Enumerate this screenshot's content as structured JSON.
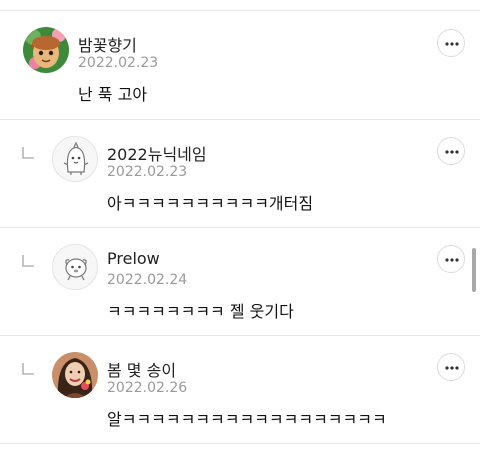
{
  "comments": [
    {
      "author": "밤꽃향기",
      "date": "2022.02.23",
      "text": "난 푹 고아",
      "is_reply": false,
      "avatar_icon": "profile-photo-avatar"
    },
    {
      "author": "2022뉴닉네임",
      "date": "2022.02.23",
      "text": "아ㅋㅋㅋㅋㅋㅋㅋㅋㅋㅋ개터짐",
      "is_reply": true,
      "avatar_icon": "default-character-avatar"
    },
    {
      "author": "Prelow",
      "date": "2022.02.24",
      "text": "ㅋㅋㅋㅋㅋㅋㅋㅋ 젤 웃기다",
      "is_reply": true,
      "avatar_icon": "default-character-avatar"
    },
    {
      "author": "봄 몇 송이",
      "date": "2022.02.26",
      "text": "알ㅋㅋㅋㅋㅋㅋㅋㅋㅋㅋㅋㅋㅋㅋㅋㅋㅋㅋ",
      "is_reply": true,
      "avatar_icon": "profile-photo-avatar"
    }
  ],
  "icons": {
    "more": "more-options-icon",
    "reply": "reply-arrow-icon"
  },
  "colors": {
    "divider": "#e8e8e8",
    "date": "#9a9a9a",
    "text": "#111111"
  }
}
